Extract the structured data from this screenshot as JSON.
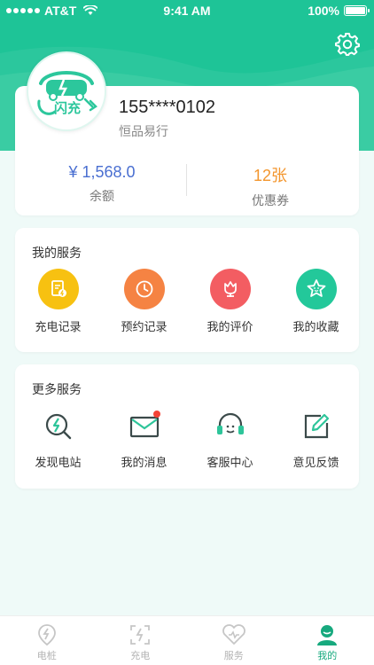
{
  "status_bar": {
    "carrier": "AT&T",
    "time": "9:41 AM",
    "battery": "100%"
  },
  "profile": {
    "phone": "155****0102",
    "company": "恒品易行",
    "logo_text": "闪充"
  },
  "stats": {
    "balance_value": "¥ 1,568.0",
    "balance_label": "余额",
    "coupon_value": "12张",
    "coupon_label": "优惠券"
  },
  "my_services": {
    "title": "我的服务",
    "items": [
      {
        "label": "充电记录",
        "icon": "charge-record-icon",
        "color": "#f7c111"
      },
      {
        "label": "预约记录",
        "icon": "reservation-clock-icon",
        "color": "#f58343"
      },
      {
        "label": "我的评价",
        "icon": "review-flower-icon",
        "color": "#f35d62"
      },
      {
        "label": "我的收藏",
        "icon": "favorite-star-icon",
        "color": "#23c89a"
      }
    ]
  },
  "more_services": {
    "title": "更多服务",
    "items": [
      {
        "label": "发现电站",
        "icon": "discover-station-icon"
      },
      {
        "label": "我的消息",
        "icon": "message-envelope-icon"
      },
      {
        "label": "客服中心",
        "icon": "customer-service-headset-icon"
      },
      {
        "label": "意见反馈",
        "icon": "feedback-edit-icon"
      }
    ]
  },
  "tab_bar": {
    "items": [
      {
        "label": "电桩",
        "icon": "charging-pile-icon",
        "active": false
      },
      {
        "label": "充电",
        "icon": "scan-charge-icon",
        "active": false
      },
      {
        "label": "服务",
        "icon": "service-heart-icon",
        "active": false
      },
      {
        "label": "我的",
        "icon": "profile-user-icon",
        "active": true
      }
    ]
  },
  "colors": {
    "brand": "#1ec497",
    "active_tab": "#17a97e",
    "balance": "#4a6fd1",
    "coupon": "#f3962e",
    "notification_dot": "#f44336"
  }
}
